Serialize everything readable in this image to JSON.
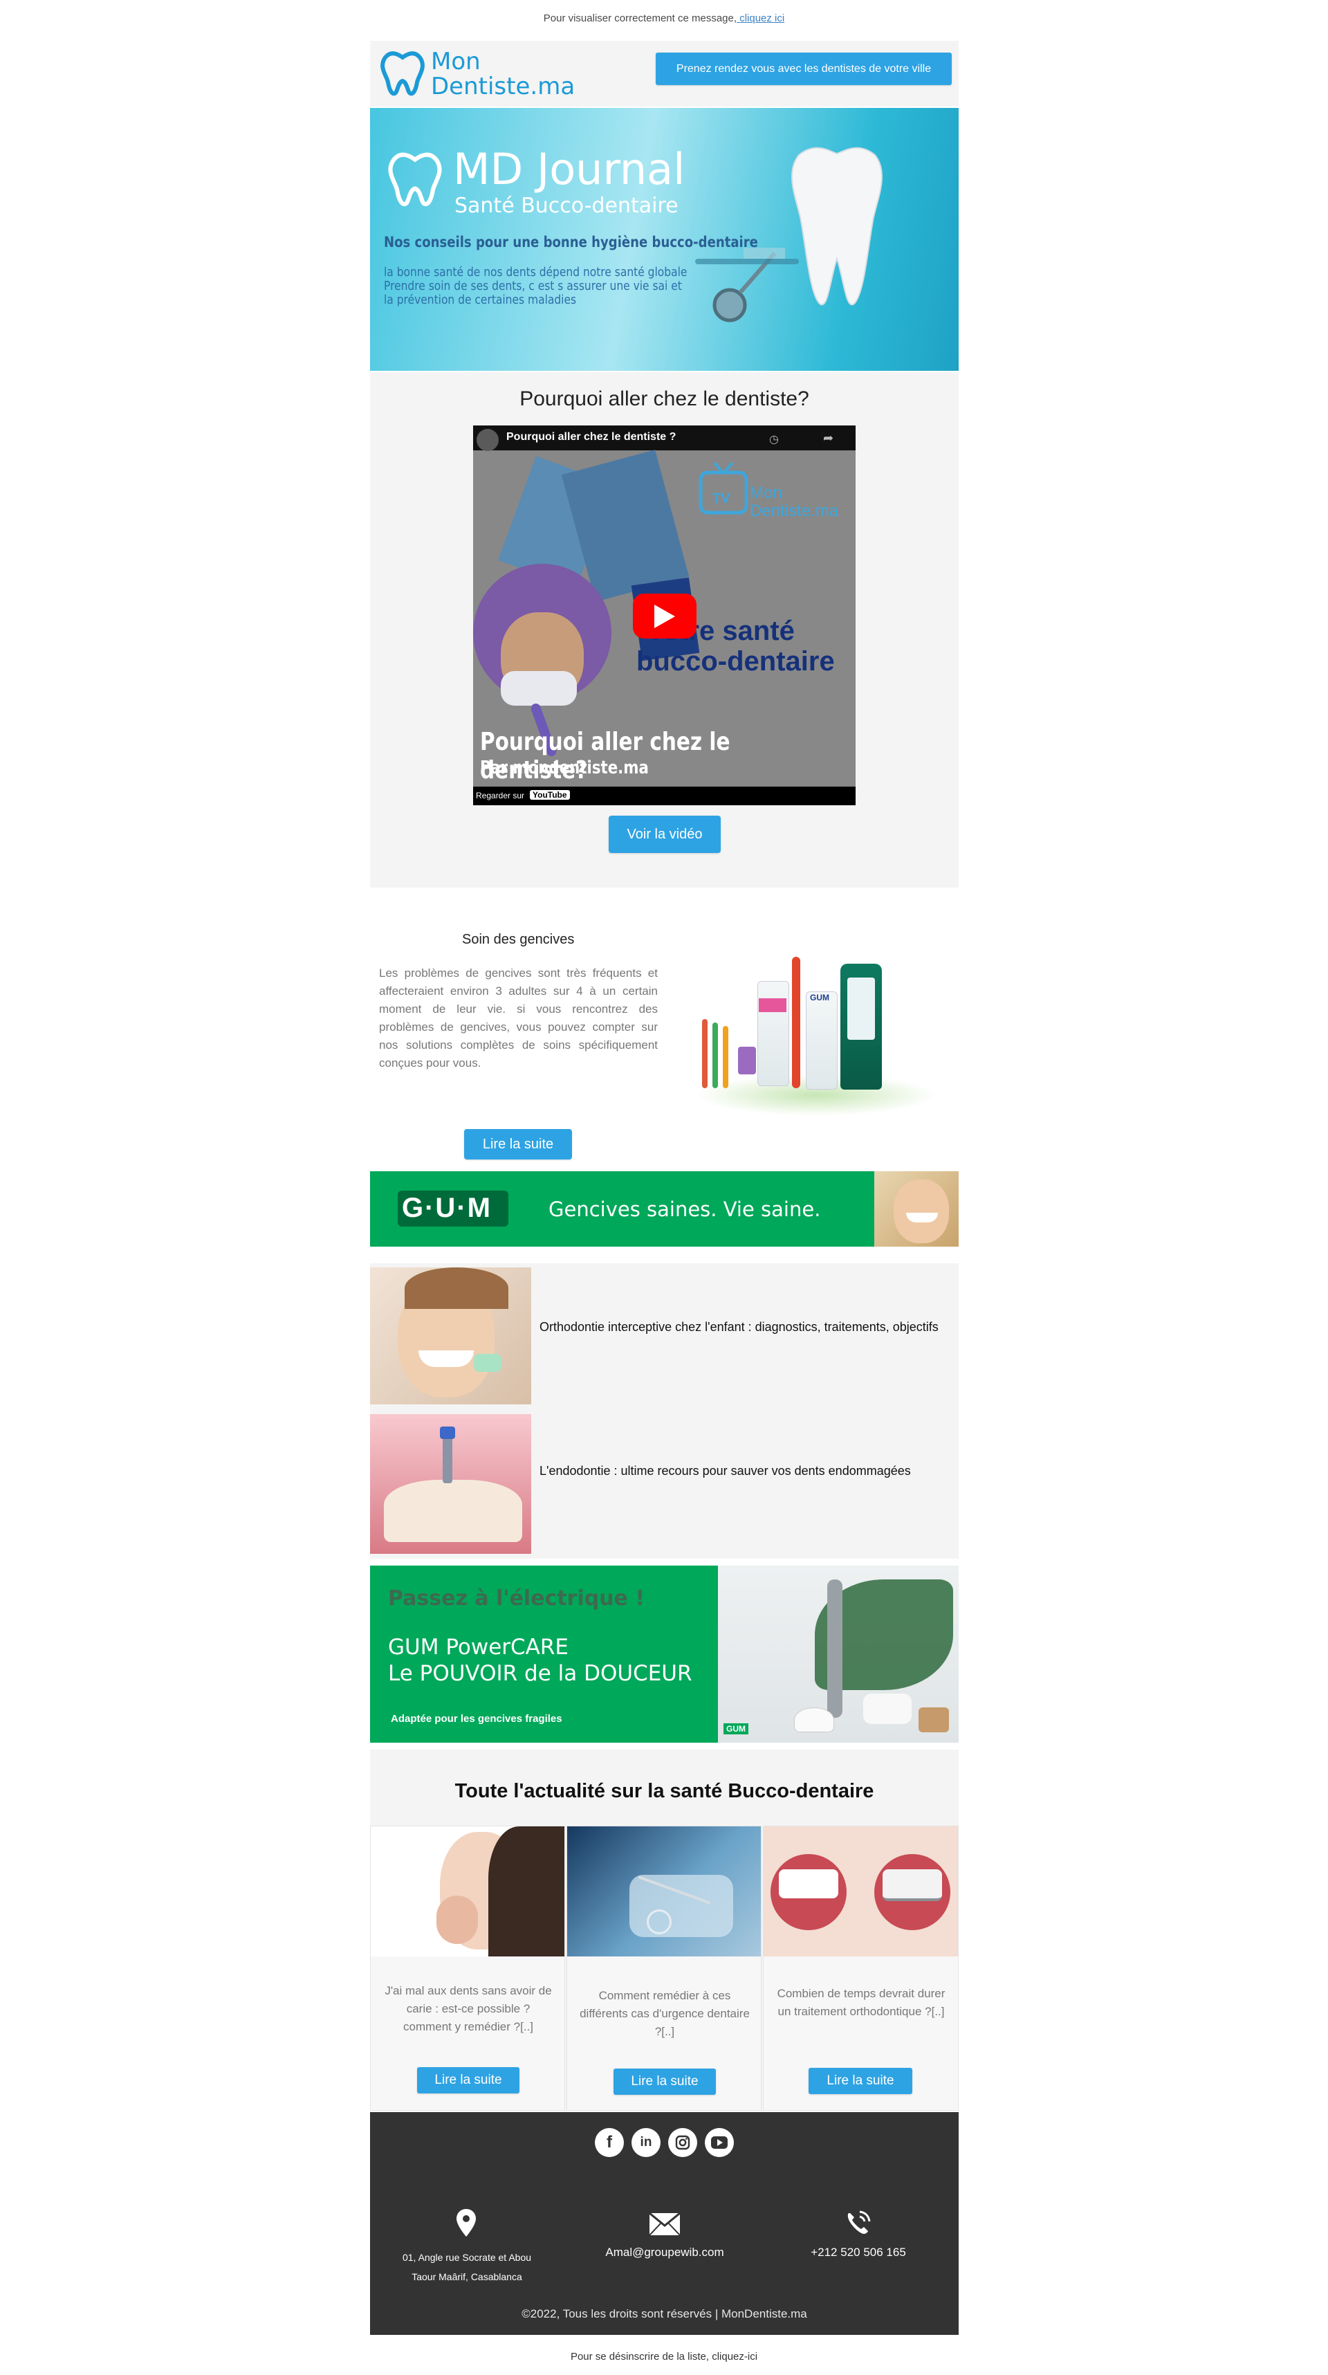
{
  "preheader": {
    "text": "Pour visualiser correctement ce message,",
    "link": " cliquez ici"
  },
  "header": {
    "logo_line1": "Mon",
    "logo_line2": "Dentiste.ma",
    "cta": "Prenez rendez vous avec les dentistes de votre ville"
  },
  "banner": {
    "title": "MD Journal",
    "subtitle": "Santé Bucco-dentaire",
    "tagline": "Nos conseils pour une bonne hygiène bucco-dentaire",
    "line1": "la bonne santé de nos dents dépend notre santé globale",
    "line2": "Prendre soin de ses dents, c  est s  assurer une vie sai et",
    "line3": "la prévention de certaines maladies"
  },
  "video_section": {
    "heading": "Pourquoi aller chez le dentiste?",
    "video_title": "Pourquoi aller chez le dentiste ?",
    "channel_tv": "TV",
    "channel_line1": "Mon",
    "channel_line2": "Dentiste.ma",
    "overlay_line1": "Votre santé",
    "overlay_line2": "bucco-dentaire",
    "overlay_title": "Pourquoi aller chez le dentiste?",
    "overlay_by": "Par mondentiste.ma",
    "watch_on": "Regarder sur",
    "youtube": "YouTube",
    "button": "Voir la vidéo"
  },
  "gums": {
    "heading": "Soin des gencives",
    "body": "Les problèmes de gencives sont très fréquents et affecteraient environ 3 adultes sur 4 à un certain moment de leur vie. si vous rencontrez des problèmes de gencives, vous pouvez compter sur nos solutions complètes de soins spécifiquement conçues pour vous.",
    "button": "Lire la suite",
    "brand": "GUM"
  },
  "gum_banner": {
    "logo": "G·U·M",
    "slogan": "Gencives saines. Vie saine."
  },
  "articles": [
    {
      "title": "Orthodontie interceptive chez l'enfant : diagnostics, traitements, objectifs"
    },
    {
      "title": "L'endodontie : ultime recours pour sauver vos dents endommagées"
    }
  ],
  "powercare": {
    "line1": "Passez à l'électrique !",
    "line2": "GUM PowerCARE",
    "line3": "Le POUVOIR de la DOUCEUR",
    "line4": "Adaptée pour les gencives fragiles",
    "badge": "GUM"
  },
  "news": {
    "heading": "Toute l'actualité sur la santé Bucco-dentaire",
    "cards": [
      {
        "text": "J'ai mal aux dents sans avoir de carie : est-ce possible ? comment y remédier ?[..]",
        "button": "Lire la suite"
      },
      {
        "text": "Comment remédier à ces différents cas d'urgence dentaire ?[..]",
        "button": "Lire la suite"
      },
      {
        "text": "Combien de temps devrait durer un traitement orthodontique ?[..]",
        "button": "Lire la suite"
      }
    ]
  },
  "footer": {
    "address_line1": "01, Angle rue Socrate et Abou",
    "address_line2": "Taour Maârif, Casablanca",
    "email": "Amal@groupewib.com",
    "phone": "+212 520 506 165",
    "copyright": "©2022, Tous les droits sont réservés | MonDentiste.ma"
  },
  "unsubscribe": "Pour se désinscrire de la liste, cliquez-ici",
  "colors": {
    "accent": "#2ea3e3",
    "gum_green": "#00a85a",
    "footer_bg": "#333333",
    "panel_bg": "#f5f5f5"
  }
}
